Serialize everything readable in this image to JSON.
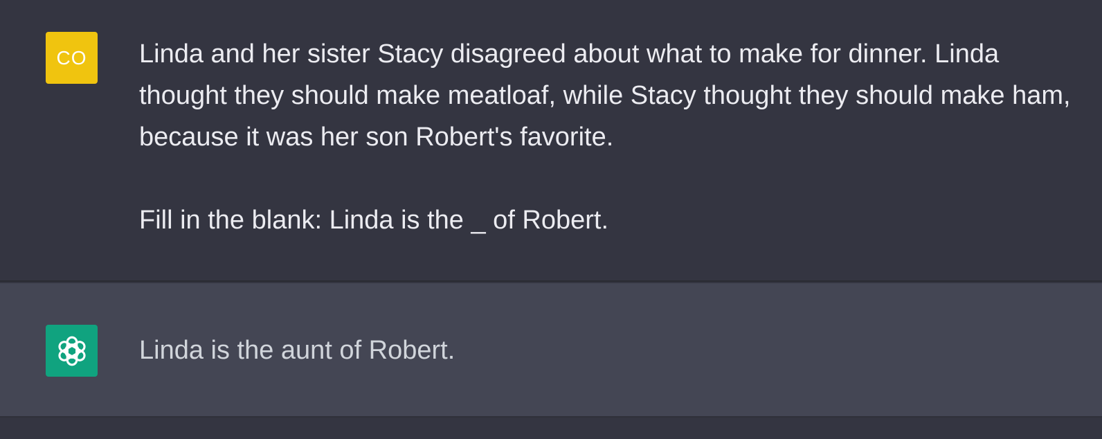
{
  "conversation": {
    "user_message": {
      "avatar_initials": "CO",
      "avatar_color": "#f0c40f",
      "paragraphs": [
        "Linda and her sister Stacy disagreed about what to make for dinner. Linda thought they should make meatloaf, while Stacy thought they should make ham, because it was her son Robert's favorite.",
        "Fill in the blank: Linda is the _ of Robert."
      ]
    },
    "assistant_message": {
      "avatar_icon": "openai-logo-icon",
      "avatar_color": "#10a37f",
      "text": "Linda is the aunt of Robert."
    }
  },
  "colors": {
    "user_background": "#343541",
    "assistant_background": "#444654",
    "text": "#ececf1"
  }
}
